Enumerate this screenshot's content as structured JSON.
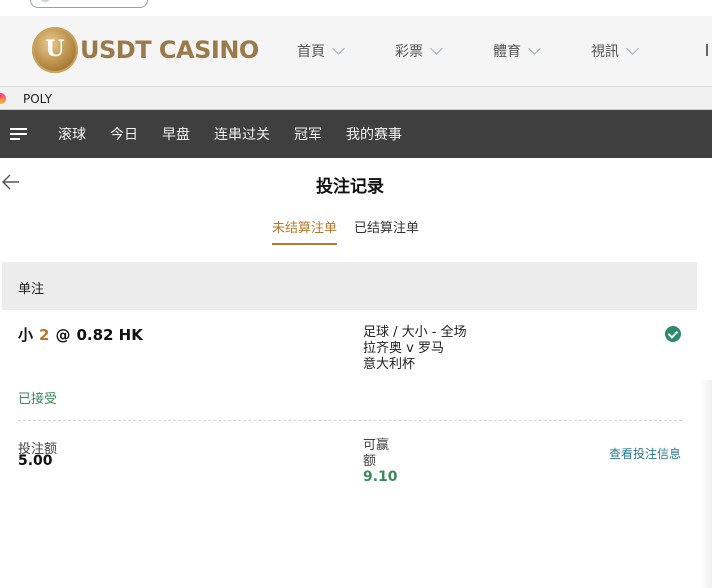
{
  "site": {
    "logo_text": "USDT CASINO",
    "logo_letter": "U",
    "nav": [
      {
        "label": "首頁"
      },
      {
        "label": "彩票"
      },
      {
        "label": "體育"
      },
      {
        "label": "視訊"
      }
    ]
  },
  "frame": {
    "title": "POLY"
  },
  "sport_nav": {
    "menu_icon": "hamburger-icon",
    "tabs": [
      {
        "label": "滚球"
      },
      {
        "label": "今日"
      },
      {
        "label": "早盘"
      },
      {
        "label": "连串过关"
      },
      {
        "label": "冠军"
      },
      {
        "label": "我的赛事"
      }
    ]
  },
  "page": {
    "back_icon": "arrow-left-icon",
    "title": "投注记录",
    "tabs": [
      {
        "label": "未结算注单",
        "active": true
      },
      {
        "label": "已结算注单",
        "active": false
      }
    ]
  },
  "bet": {
    "section_label": "单注",
    "selection": "小",
    "line": "2",
    "at": "@",
    "odds": "0.82 HK",
    "market": "足球 / 大小 - 全场",
    "match": "拉齐奥 v 罗马",
    "league": "意大利杯",
    "status_icon": "check-circle-icon",
    "status": "已接受",
    "stake_label": "投注额",
    "stake_value": "5.00",
    "win_label": "可赢额",
    "win_value": "9.10",
    "detail_link": "查看投注信息"
  },
  "colors": {
    "accent": "#b8792f",
    "success": "#3a8a58",
    "nav_bg": "#3f3f3f",
    "link": "#2a7a8c"
  }
}
